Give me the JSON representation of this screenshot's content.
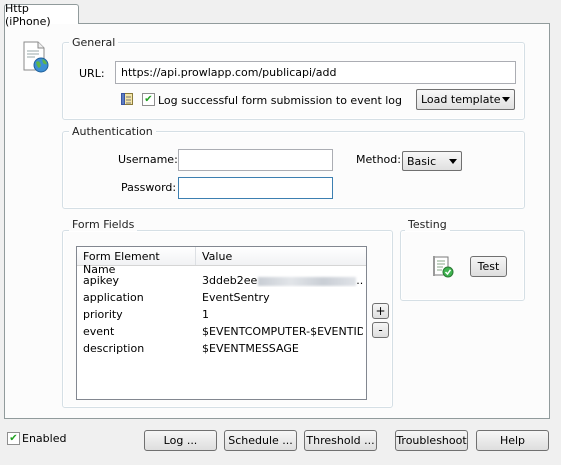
{
  "tab": {
    "label": "Http (iPhone)"
  },
  "general": {
    "label": "General",
    "url_label": "URL:",
    "url_value": "https://api.prowlapp.com/publicapi/add",
    "log_checkbox_label": "Log successful form submission to event log",
    "log_checked": true,
    "load_template_label": "Load template"
  },
  "auth": {
    "label": "Authentication",
    "username_label": "Username:",
    "username_value": "",
    "password_label": "Password:",
    "password_value": "",
    "method_label": "Method:",
    "method_value": "Basic"
  },
  "form_fields": {
    "label": "Form Fields",
    "columns": [
      "Form Element Name",
      "Value"
    ],
    "rows": [
      {
        "name": "apikey",
        "value": "3ddeb2ee",
        "masked": true,
        "suffix": "..."
      },
      {
        "name": "application",
        "value": "EventSentry"
      },
      {
        "name": "priority",
        "value": "1"
      },
      {
        "name": "event",
        "value": "$EVENTCOMPUTER-$EVENTID..."
      },
      {
        "name": "description",
        "value": "$EVENTMESSAGE"
      }
    ],
    "add_label": "+",
    "remove_label": "-"
  },
  "testing": {
    "label": "Testing",
    "test_button": "Test"
  },
  "footer": {
    "enabled_label": "Enabled",
    "enabled_checked": true,
    "buttons": {
      "log": "Log ...",
      "schedule": "Schedule ...",
      "threshold": "Threshold ...",
      "troubleshoot": "Troubleshoot",
      "help": "Help"
    }
  },
  "icons": {
    "page": "web-page-globe-icon",
    "log": "event-log-icon",
    "test": "test-checklist-icon"
  }
}
